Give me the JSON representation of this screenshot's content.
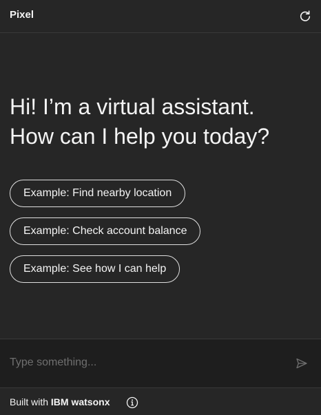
{
  "header": {
    "title": "Pixel",
    "restart_icon": "restart-icon"
  },
  "greeting": {
    "line1": "Hi! I’m a virtual assistant.",
    "line2": "How can I help you today?"
  },
  "examples": [
    {
      "label": "Example: Find nearby location"
    },
    {
      "label": "Example: Check account balance"
    },
    {
      "label": "Example: See how I can help"
    }
  ],
  "input": {
    "placeholder": "Type something...",
    "value": "",
    "send_icon": "send-icon"
  },
  "footer": {
    "prefix": "Built with ",
    "brand": "IBM watsonx",
    "info_icon": "info-icon"
  },
  "colors": {
    "background": "#262626",
    "input_background": "#1e1e1e",
    "text": "#f4f4f4",
    "placeholder": "#6f6f6f",
    "border": "#393939"
  }
}
